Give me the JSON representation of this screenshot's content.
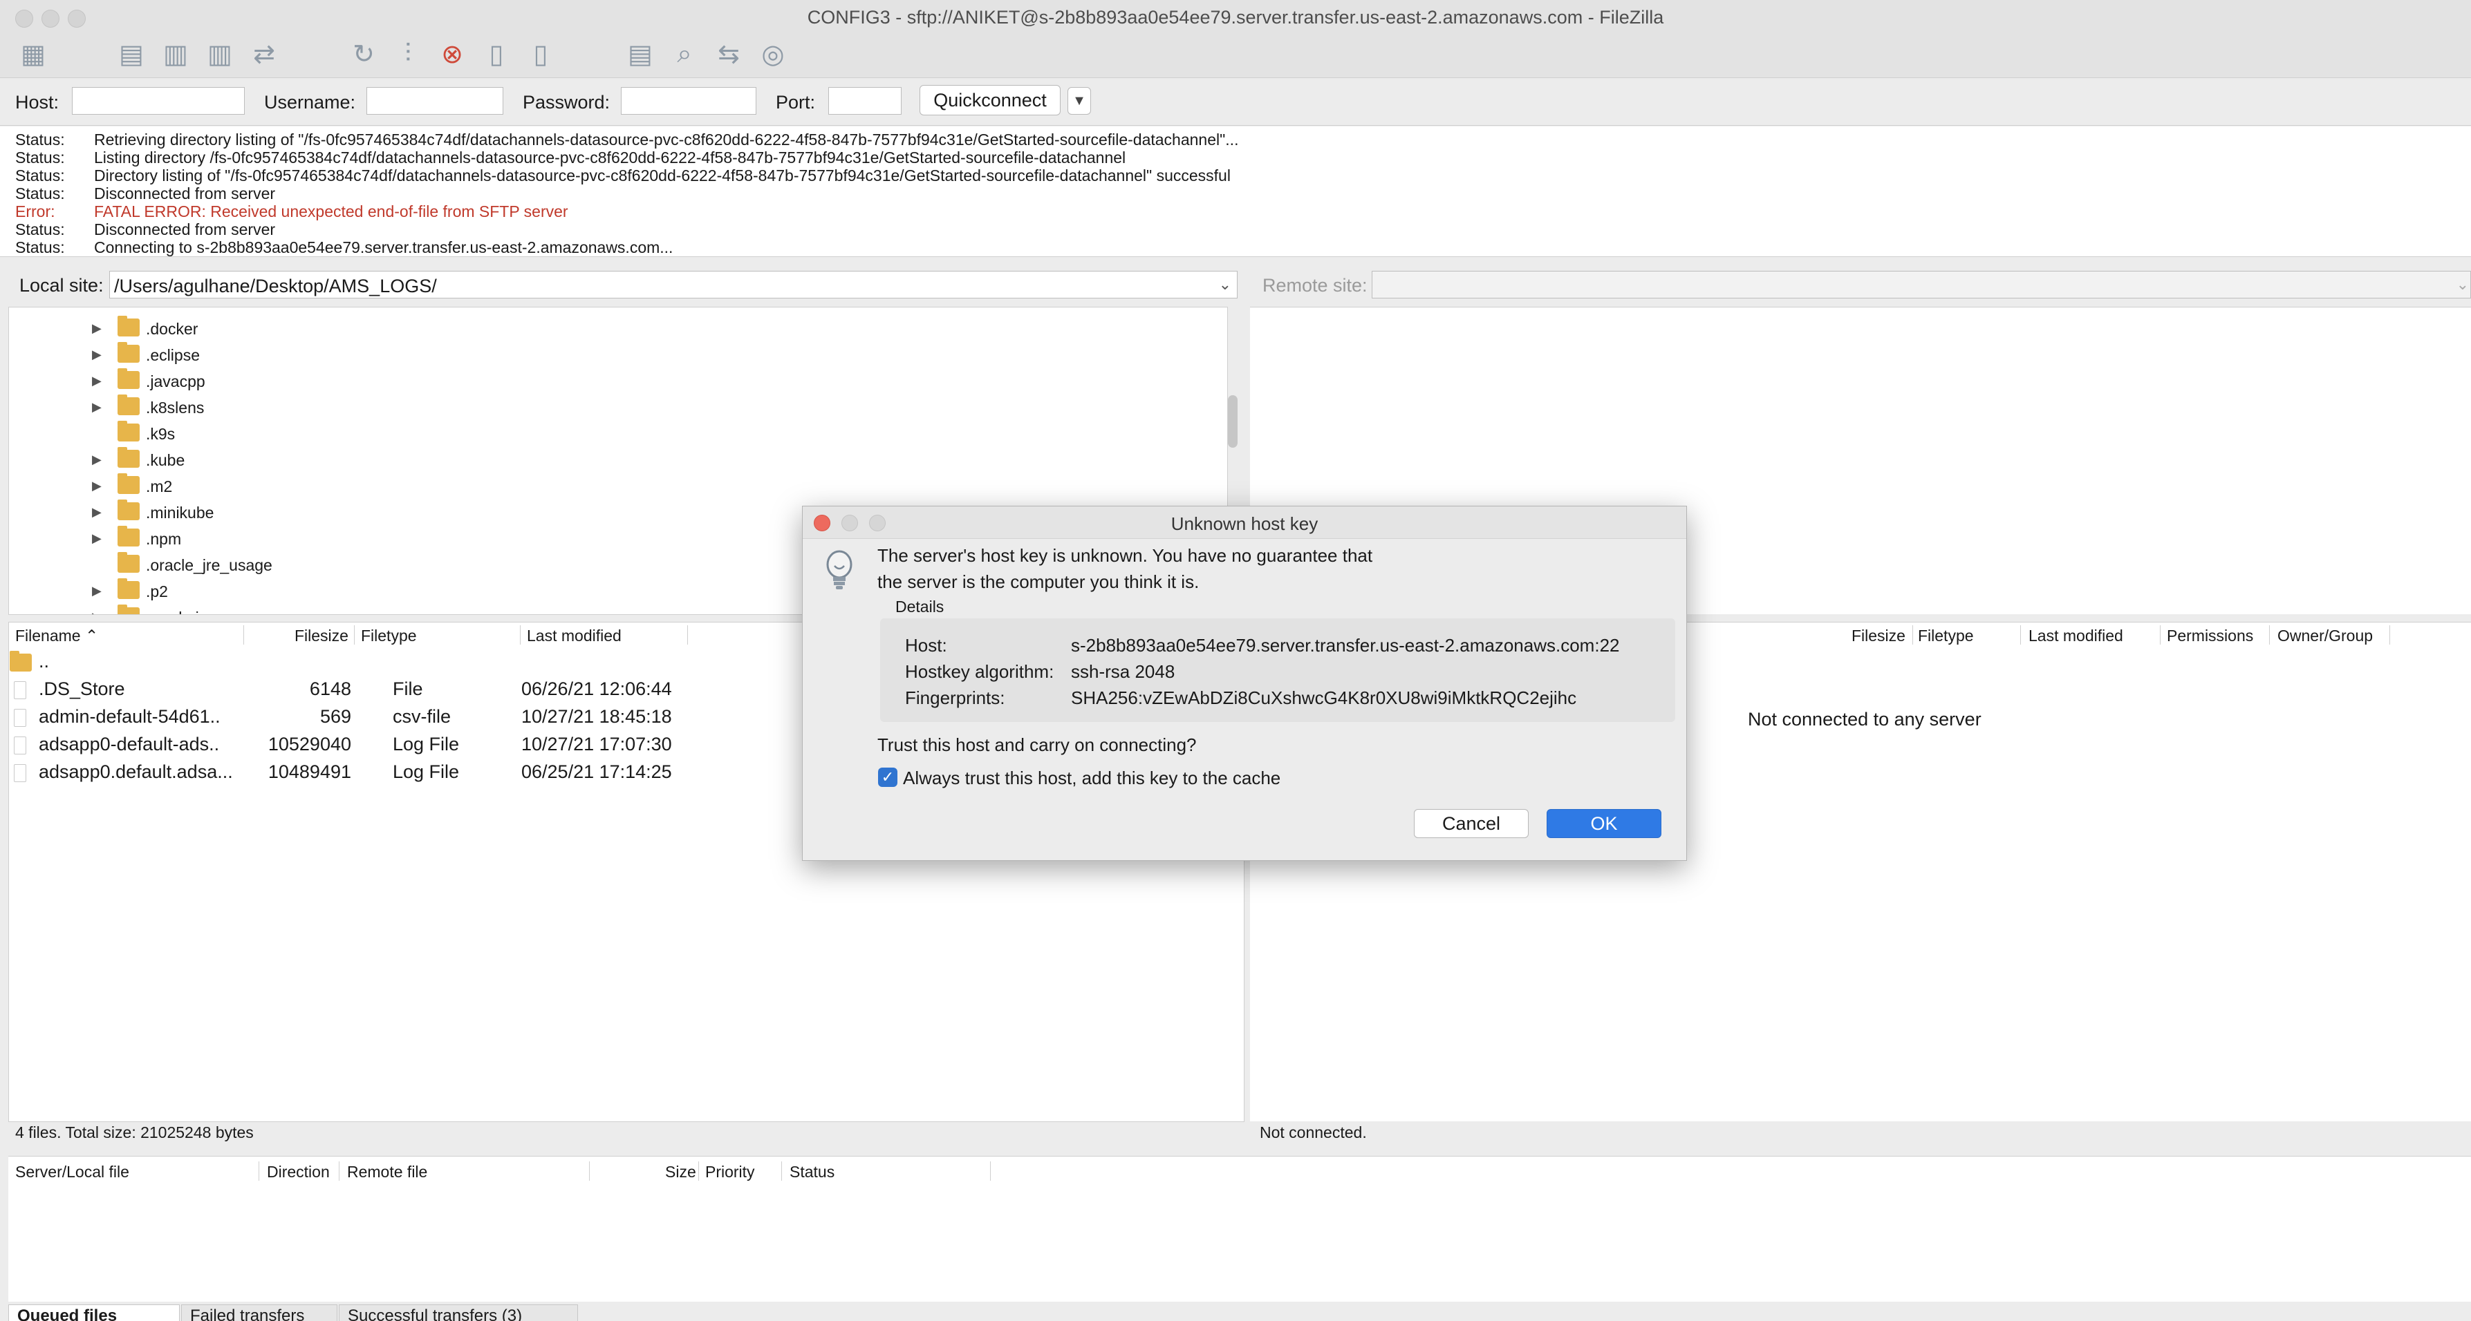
{
  "window": {
    "title": "CONFIG3 - sftp://ANIKET@s-2b8b893aa0e54ee79.server.transfer.us-east-2.amazonaws.com - FileZilla"
  },
  "toolbar": {
    "icons": [
      "site-manager-icon",
      "log-icon",
      "local-tree-icon",
      "remote-tree-icon",
      "queue-icon",
      "refresh-icon",
      "filter-icon",
      "cancel-icon",
      "disconnect-icon",
      "reconnect-icon",
      "compare-icon",
      "search-icon",
      "sync-icon",
      "find-icon"
    ]
  },
  "quickconnect": {
    "host_label": "Host:",
    "username_label": "Username:",
    "password_label": "Password:",
    "port_label": "Port:",
    "host_value": "",
    "username_value": "",
    "password_value": "",
    "port_value": "",
    "button_label": "Quickconnect",
    "dropdown_glyph": "▼"
  },
  "log": [
    {
      "kind": "Status:",
      "text": "Retrieving directory listing of \"/fs-0fc957465384c74df/datachannels-datasource-pvc-c8f620dd-6222-4f58-847b-7577bf94c31e/GetStarted-sourcefile-datachannel\"...",
      "error": false
    },
    {
      "kind": "Status:",
      "text": "Listing directory /fs-0fc957465384c74df/datachannels-datasource-pvc-c8f620dd-6222-4f58-847b-7577bf94c31e/GetStarted-sourcefile-datachannel",
      "error": false
    },
    {
      "kind": "Status:",
      "text": "Directory listing of \"/fs-0fc957465384c74df/datachannels-datasource-pvc-c8f620dd-6222-4f58-847b-7577bf94c31e/GetStarted-sourcefile-datachannel\" successful",
      "error": false
    },
    {
      "kind": "Status:",
      "text": "Disconnected from server",
      "error": false
    },
    {
      "kind": "Error:",
      "text": "FATAL ERROR: Received unexpected end-of-file from SFTP server",
      "error": true
    },
    {
      "kind": "Status:",
      "text": "Disconnected from server",
      "error": false
    },
    {
      "kind": "Status:",
      "text": "Connecting to s-2b8b893aa0e54ee79.server.transfer.us-east-2.amazonaws.com...",
      "error": false
    }
  ],
  "local": {
    "site_label": "Local site:",
    "path": "/Users/agulhane/Desktop/AMS_LOGS/",
    "tree": [
      {
        "name": ".docker",
        "expandable": true
      },
      {
        "name": ".eclipse",
        "expandable": true
      },
      {
        "name": ".javacpp",
        "expandable": true
      },
      {
        "name": ".k8slens",
        "expandable": true
      },
      {
        "name": ".k9s",
        "expandable": false
      },
      {
        "name": ".kube",
        "expandable": true
      },
      {
        "name": ".m2",
        "expandable": true
      },
      {
        "name": ".minikube",
        "expandable": true
      },
      {
        "name": ".npm",
        "expandable": true
      },
      {
        "name": ".oracle_jre_usage",
        "expandable": false
      },
      {
        "name": ".p2",
        "expandable": true
      },
      {
        "name": ".gradmin",
        "expandable": true
      }
    ],
    "columns": {
      "filename": "Filename",
      "sort_glyph": "⌃",
      "filesize": "Filesize",
      "filetype": "Filetype",
      "last_modified": "Last modified"
    },
    "files": [
      {
        "name": "..",
        "size": "",
        "type": "",
        "modified": "",
        "folder": true
      },
      {
        "name": ".DS_Store",
        "size": "6148",
        "type": "File",
        "modified": "06/26/21 12:06:44",
        "folder": false
      },
      {
        "name": "admin-default-54d61..",
        "size": "569",
        "type": "csv-file",
        "modified": "10/27/21 18:45:18",
        "folder": false
      },
      {
        "name": "adsapp0-default-ads..",
        "size": "10529040",
        "type": "Log File",
        "modified": "10/27/21 17:07:30",
        "folder": false
      },
      {
        "name": "adsapp0.default.adsa...",
        "size": "10489491",
        "type": "Log File",
        "modified": "06/25/21 17:14:25",
        "folder": false
      }
    ],
    "status": "4 files. Total size: 21025248 bytes"
  },
  "remote": {
    "site_label": "Remote site:",
    "columns": {
      "filesize": "Filesize",
      "filetype": "Filetype",
      "last_modified": "Last modified",
      "permissions": "Permissions",
      "owner_group": "Owner/Group"
    },
    "empty_message": "Not connected to any server",
    "status": "Not connected."
  },
  "queue": {
    "columns": {
      "server_local": "Server/Local file",
      "direction": "Direction",
      "remote_file": "Remote file",
      "size": "Size",
      "priority": "Priority",
      "status": "Status"
    },
    "tabs": [
      "Queued files",
      "Failed transfers",
      "Successful transfers (3)"
    ]
  },
  "dialog": {
    "title": "Unknown host key",
    "message_line1": "The server's host key is unknown. You have no guarantee that",
    "message_line2": "the server is the computer you think it is.",
    "details_label": "Details",
    "host_label": "Host:",
    "host_value": "s-2b8b893aa0e54ee79.server.transfer.us-east-2.amazonaws.com:22",
    "algorithm_label": "Hostkey algorithm:",
    "algorithm_value": "ssh-rsa 2048",
    "fingerprint_label": "Fingerprints:",
    "fingerprint_value": "SHA256:vZEwAbDZi8CuXshwcG4K8r0XU8wi9iMktkRQC2ejihc",
    "question": "Trust this host and carry on connecting?",
    "checkbox_label": "Always trust this host, add this key to the cache",
    "checkbox_checked": true,
    "checkbox_glyph": "✓",
    "cancel_label": "Cancel",
    "ok_label": "OK"
  },
  "colors": {
    "accent": "#2f7ae5",
    "error": "#c0392b",
    "folder": "#e7b54a",
    "close": "#ed6a5e"
  }
}
